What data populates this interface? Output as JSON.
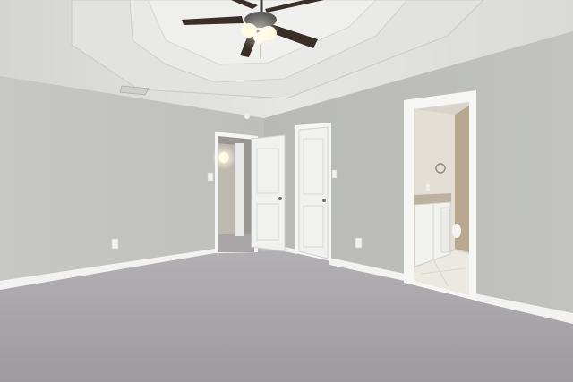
{
  "scene": {
    "subject": "empty-bedroom-interior",
    "colors": {
      "wall": "#c4c4c1",
      "wall_right": "#b9bab6",
      "ceiling": "#dedede",
      "trim": "#f3f3f1",
      "carpet": "#a8a5aa",
      "door": "#f1f1ef",
      "fan_blade": "#3a2e28",
      "bath_tile": "#ece9e2"
    },
    "icons": [
      "ceiling-fan-icon",
      "outlet-icon",
      "light-switch-icon",
      "towel-ring-icon",
      "doorknob-icon"
    ]
  }
}
